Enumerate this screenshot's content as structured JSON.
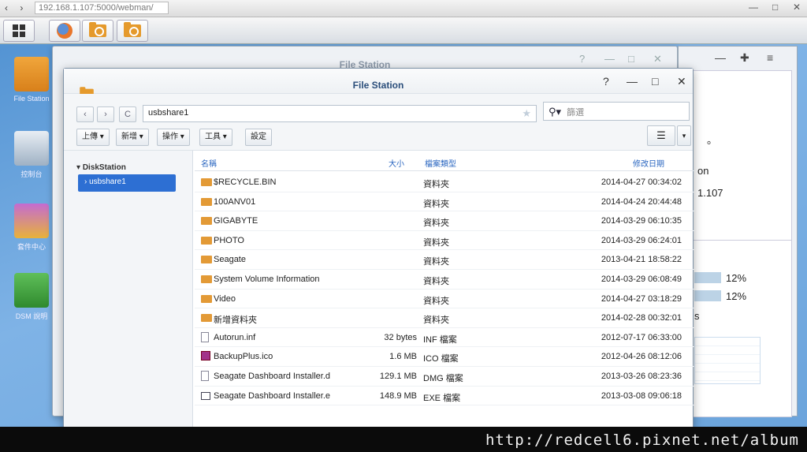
{
  "browser": {
    "url": "192.168.1.107:5000/webman/",
    "nav_glyphs": "‹ › C"
  },
  "desktop": {
    "icons": [
      {
        "label": "File Station"
      },
      {
        "label": "控制台"
      },
      {
        "label": "套件中心"
      },
      {
        "label": "DSM 說明"
      }
    ]
  },
  "background_window": {
    "title": "File Station"
  },
  "right_panel": {
    "texts": [
      "。",
      "on",
      "1.107",
      "12%",
      "12%",
      "s"
    ],
    "cpu_fraction": 0.12,
    "ram_fraction": 0.12
  },
  "window": {
    "title": "File Station",
    "controls": {
      "help": "?",
      "minimize": "—",
      "maximize": "□",
      "close": "✕"
    },
    "path": "usbshare1",
    "search_placeholder": "篩選",
    "toolbar": {
      "upload": "上傳 ▾",
      "create": "新增 ▾",
      "action": "操作 ▾",
      "tools": "工具 ▾",
      "settings": "設定"
    },
    "sidebar": {
      "root": "DiskStation",
      "selected": "usbshare1"
    },
    "columns": {
      "name": "名稱",
      "size": "大小",
      "type": "檔案類型",
      "modified": "修改日期"
    },
    "rows": [
      {
        "icon": "folder",
        "name": "$RECYCLE.BIN",
        "size": "",
        "type": "資料夾",
        "date": "2014-04-27 00:34:02"
      },
      {
        "icon": "folder",
        "name": "100ANV01",
        "size": "",
        "type": "資料夾",
        "date": "2014-04-24 20:44:48"
      },
      {
        "icon": "folder",
        "name": "GIGABYTE",
        "size": "",
        "type": "資料夾",
        "date": "2014-03-29 06:10:35"
      },
      {
        "icon": "folder",
        "name": "PHOTO",
        "size": "",
        "type": "資料夾",
        "date": "2014-03-29 06:24:01"
      },
      {
        "icon": "folder",
        "name": "Seagate",
        "size": "",
        "type": "資料夾",
        "date": "2013-04-21 18:58:22"
      },
      {
        "icon": "folder",
        "name": "System Volume Information",
        "size": "",
        "type": "資料夾",
        "date": "2014-03-29 06:08:49"
      },
      {
        "icon": "folder",
        "name": "Video",
        "size": "",
        "type": "資料夾",
        "date": "2014-04-27 03:18:29"
      },
      {
        "icon": "folder",
        "name": "新增資料夾",
        "size": "",
        "type": "資料夾",
        "date": "2014-02-28 00:32:01"
      },
      {
        "icon": "file",
        "name": "Autorun.inf",
        "size": "32 bytes",
        "type": "INF 檔案",
        "date": "2012-07-17 06:33:00"
      },
      {
        "icon": "ico",
        "name": "BackupPlus.ico",
        "size": "1.6 MB",
        "type": "ICO 檔案",
        "date": "2012-04-26 08:12:06"
      },
      {
        "icon": "file",
        "name": "Seagate Dashboard Installer.d",
        "size": "129.1 MB",
        "type": "DMG 檔案",
        "date": "2013-03-26 08:23:36"
      },
      {
        "icon": "win",
        "name": "Seagate Dashboard Installer.e",
        "size": "148.9 MB",
        "type": "EXE 檔案",
        "date": "2013-03-08 09:06:18"
      }
    ]
  },
  "watermark": "http://redcell6.pixnet.net/album"
}
